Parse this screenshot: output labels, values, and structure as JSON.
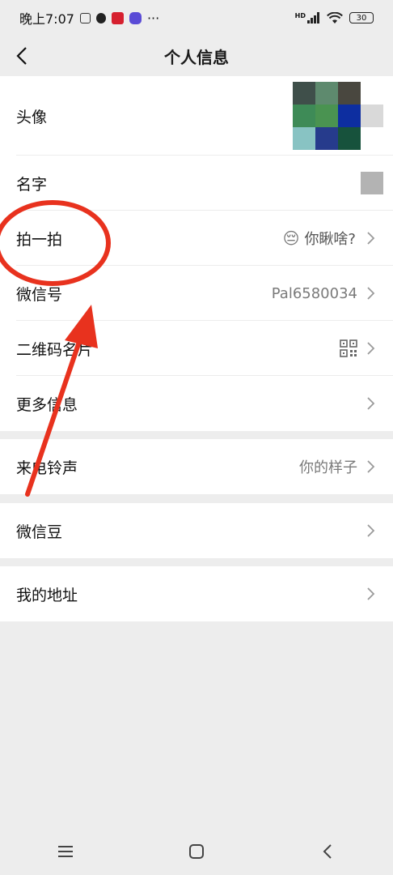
{
  "status_bar": {
    "time": "晚上7:07",
    "dots": "···",
    "hd": "HD",
    "battery": "30"
  },
  "header": {
    "title": "个人信息"
  },
  "profile": {
    "avatar_label": "头像",
    "name_label": "名字",
    "pat_label": "拍一拍",
    "pat_emoji": "😔",
    "pat_value": "你瞅啥?",
    "wechat_id_label": "微信号",
    "wechat_id_value": "Pal6580034",
    "qrcode_label": "二维码名片",
    "more_label": "更多信息"
  },
  "ringtone": {
    "label": "来电铃声",
    "value": "你的样子"
  },
  "beans": {
    "label": "微信豆"
  },
  "address": {
    "label": "我的地址"
  },
  "colors": {
    "annotation_red": "#e8321e",
    "background": "#ededed"
  },
  "icons": [
    "back-arrow-icon",
    "chevron-right-icon",
    "qrcode-icon",
    "menu-icon",
    "home-icon",
    "back-icon"
  ]
}
